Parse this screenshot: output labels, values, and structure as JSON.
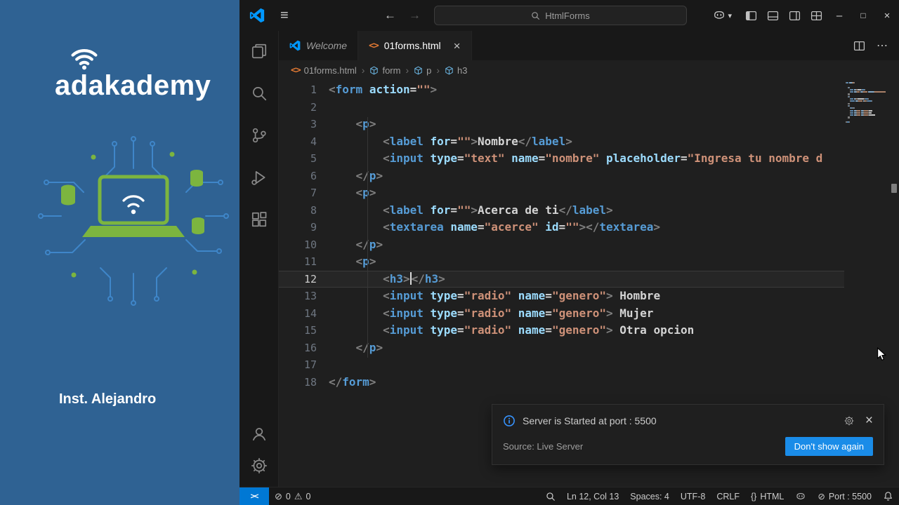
{
  "colors": {
    "left_panel_bg": "#2f6293",
    "chrome_bg": "#181818",
    "editor_bg": "#1f1f1f",
    "accent_blue": "#0078d4",
    "notification_button": "#1a8ce8",
    "tag": "#569cd6",
    "attribute": "#9cdcfe",
    "string": "#ce9178",
    "punctuation": "#808080",
    "plain_text": "#d4d4d4",
    "html_icon_orange": "#e37933",
    "illustration_green": "#7cb53f",
    "illustration_blue": "#3f86c9"
  },
  "icons": {
    "menu": "≡",
    "back": "←",
    "forward": "→",
    "chevron_down": "▾",
    "more": "⋯",
    "minimize": "–",
    "maximize": "□",
    "close": "×",
    "tab_close": "×",
    "error": "⊘",
    "warning": "⚠",
    "breadcrumb_sep": "›",
    "html_file": "<>",
    "lang_braces": "{}",
    "port_slash": "⊘",
    "remote": "><"
  },
  "left_panel": {
    "brand": "adakademy",
    "instructor": "Inst. Alejandro"
  },
  "titlebar": {
    "search_label": "HtmlForms"
  },
  "tabs": [
    {
      "label": "Welcome",
      "active": false
    },
    {
      "label": "01forms.html",
      "active": true
    }
  ],
  "breadcrumb": [
    "01forms.html",
    "form",
    "p",
    "h3"
  ],
  "editor": {
    "active_line": 12,
    "lines": [
      {
        "n": 1,
        "t": [
          [
            "p",
            "<"
          ],
          [
            "t",
            "form"
          ],
          [
            "x",
            " "
          ],
          [
            "a",
            "action"
          ],
          [
            "o",
            "="
          ],
          [
            "s",
            "\"\""
          ],
          [
            "p",
            ">"
          ]
        ]
      },
      {
        "n": 2,
        "t": []
      },
      {
        "n": 3,
        "t": [
          [
            "x",
            "    "
          ],
          [
            "p",
            "<"
          ],
          [
            "t",
            "p"
          ],
          [
            "p",
            ">"
          ]
        ]
      },
      {
        "n": 4,
        "t": [
          [
            "x",
            "        "
          ],
          [
            "p",
            "<"
          ],
          [
            "t",
            "label"
          ],
          [
            "x",
            " "
          ],
          [
            "a",
            "for"
          ],
          [
            "o",
            "="
          ],
          [
            "s",
            "\"\""
          ],
          [
            "p",
            ">"
          ],
          [
            "x",
            "Nombre"
          ],
          [
            "p",
            "</"
          ],
          [
            "t",
            "label"
          ],
          [
            "p",
            ">"
          ]
        ]
      },
      {
        "n": 5,
        "t": [
          [
            "x",
            "        "
          ],
          [
            "p",
            "<"
          ],
          [
            "t",
            "input"
          ],
          [
            "x",
            " "
          ],
          [
            "a",
            "type"
          ],
          [
            "o",
            "="
          ],
          [
            "s",
            "\"text\""
          ],
          [
            "x",
            " "
          ],
          [
            "a",
            "name"
          ],
          [
            "o",
            "="
          ],
          [
            "s",
            "\"nombre\""
          ],
          [
            "x",
            " "
          ],
          [
            "a",
            "placeholder"
          ],
          [
            "o",
            "="
          ],
          [
            "s",
            "\"Ingresa tu nombre d"
          ]
        ]
      },
      {
        "n": 6,
        "t": [
          [
            "x",
            "    "
          ],
          [
            "p",
            "</"
          ],
          [
            "t",
            "p"
          ],
          [
            "p",
            ">"
          ]
        ]
      },
      {
        "n": 7,
        "t": [
          [
            "x",
            "    "
          ],
          [
            "p",
            "<"
          ],
          [
            "t",
            "p"
          ],
          [
            "p",
            ">"
          ]
        ]
      },
      {
        "n": 8,
        "t": [
          [
            "x",
            "        "
          ],
          [
            "p",
            "<"
          ],
          [
            "t",
            "label"
          ],
          [
            "x",
            " "
          ],
          [
            "a",
            "for"
          ],
          [
            "o",
            "="
          ],
          [
            "s",
            "\"\""
          ],
          [
            "p",
            ">"
          ],
          [
            "x",
            "Acerca de ti"
          ],
          [
            "p",
            "</"
          ],
          [
            "t",
            "label"
          ],
          [
            "p",
            ">"
          ]
        ]
      },
      {
        "n": 9,
        "t": [
          [
            "x",
            "        "
          ],
          [
            "p",
            "<"
          ],
          [
            "t",
            "textarea"
          ],
          [
            "x",
            " "
          ],
          [
            "a",
            "name"
          ],
          [
            "o",
            "="
          ],
          [
            "s",
            "\"acerce\""
          ],
          [
            "x",
            " "
          ],
          [
            "a",
            "id"
          ],
          [
            "o",
            "="
          ],
          [
            "s",
            "\"\""
          ],
          [
            "p",
            ">"
          ],
          [
            "p",
            "</"
          ],
          [
            "t",
            "textarea"
          ],
          [
            "p",
            ">"
          ]
        ]
      },
      {
        "n": 10,
        "t": [
          [
            "x",
            "    "
          ],
          [
            "p",
            "</"
          ],
          [
            "t",
            "p"
          ],
          [
            "p",
            ">"
          ]
        ]
      },
      {
        "n": 11,
        "t": [
          [
            "x",
            "    "
          ],
          [
            "p",
            "<"
          ],
          [
            "t",
            "p"
          ],
          [
            "p",
            ">"
          ]
        ]
      },
      {
        "n": 12,
        "t": [
          [
            "x",
            "        "
          ],
          [
            "p",
            "<"
          ],
          [
            "t",
            "h3"
          ],
          [
            "p",
            ">"
          ],
          [
            "c",
            ""
          ],
          [
            "p",
            "</"
          ],
          [
            "t",
            "h3"
          ],
          [
            "p",
            ">"
          ]
        ]
      },
      {
        "n": 13,
        "t": [
          [
            "x",
            "        "
          ],
          [
            "p",
            "<"
          ],
          [
            "t",
            "input"
          ],
          [
            "x",
            " "
          ],
          [
            "a",
            "type"
          ],
          [
            "o",
            "="
          ],
          [
            "s",
            "\"radio\""
          ],
          [
            "x",
            " "
          ],
          [
            "a",
            "name"
          ],
          [
            "o",
            "="
          ],
          [
            "s",
            "\"genero\""
          ],
          [
            "p",
            ">"
          ],
          [
            "x",
            " Hombre"
          ]
        ]
      },
      {
        "n": 14,
        "t": [
          [
            "x",
            "        "
          ],
          [
            "p",
            "<"
          ],
          [
            "t",
            "input"
          ],
          [
            "x",
            " "
          ],
          [
            "a",
            "type"
          ],
          [
            "o",
            "="
          ],
          [
            "s",
            "\"radio\""
          ],
          [
            "x",
            " "
          ],
          [
            "a",
            "name"
          ],
          [
            "o",
            "="
          ],
          [
            "s",
            "\"genero\""
          ],
          [
            "p",
            ">"
          ],
          [
            "x",
            " Mujer"
          ]
        ]
      },
      {
        "n": 15,
        "t": [
          [
            "x",
            "        "
          ],
          [
            "p",
            "<"
          ],
          [
            "t",
            "input"
          ],
          [
            "x",
            " "
          ],
          [
            "a",
            "type"
          ],
          [
            "o",
            "="
          ],
          [
            "s",
            "\"radio\""
          ],
          [
            "x",
            " "
          ],
          [
            "a",
            "name"
          ],
          [
            "o",
            "="
          ],
          [
            "s",
            "\"genero\""
          ],
          [
            "p",
            ">"
          ],
          [
            "x",
            " Otra opcion"
          ]
        ]
      },
      {
        "n": 16,
        "t": [
          [
            "x",
            "    "
          ],
          [
            "p",
            "</"
          ],
          [
            "t",
            "p"
          ],
          [
            "p",
            ">"
          ]
        ]
      },
      {
        "n": 17,
        "t": []
      },
      {
        "n": 18,
        "t": [
          [
            "p",
            "</"
          ],
          [
            "t",
            "form"
          ],
          [
            "p",
            ">"
          ]
        ]
      }
    ]
  },
  "notification": {
    "title": "Server is Started at port : 5500",
    "source": "Source: Live Server",
    "button_label": "Don't show again"
  },
  "statusbar": {
    "errors": "0",
    "warnings": "0",
    "line_col": "Ln 12, Col 13",
    "spaces": "Spaces: 4",
    "encoding": "UTF-8",
    "eol": "CRLF",
    "language": "HTML",
    "port": "Port : 5500"
  }
}
